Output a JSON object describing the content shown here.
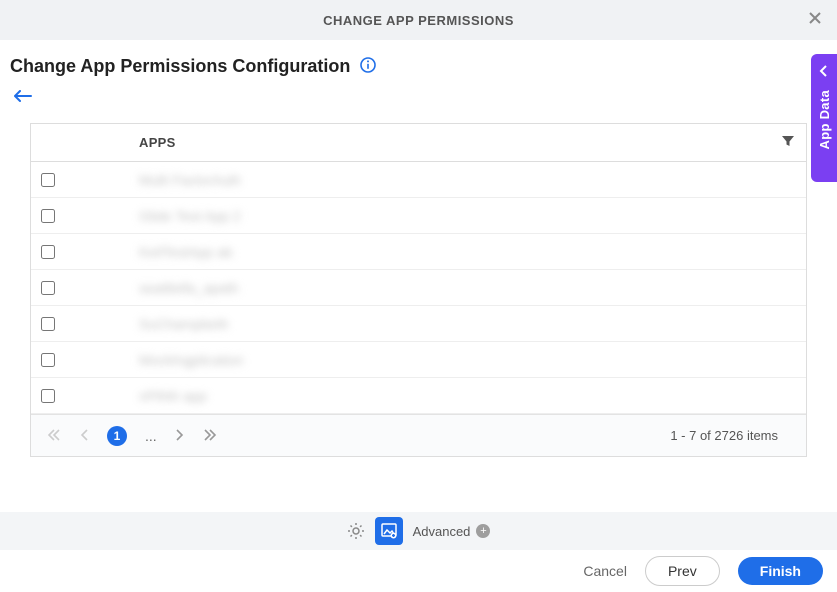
{
  "header": {
    "title": "CHANGE APP PERMISSIONS"
  },
  "page": {
    "title": "Change App Permissions Configuration"
  },
  "table": {
    "column_header": "APPS",
    "rows": [
      "Multi FactorAuth",
      "Glide Test App 2",
      "KeilTestApp ab",
      "seattletfa_apath",
      "SuChampbeth",
      "MockIngplication",
      "nPthth app"
    ]
  },
  "pagination": {
    "current_page": "1",
    "ellipsis": "...",
    "item_count": "1 - 7 of 2726 items"
  },
  "toolbar": {
    "advanced_label": "Advanced"
  },
  "footer": {
    "cancel": "Cancel",
    "prev": "Prev",
    "finish": "Finish"
  },
  "side": {
    "label": "App Data"
  }
}
